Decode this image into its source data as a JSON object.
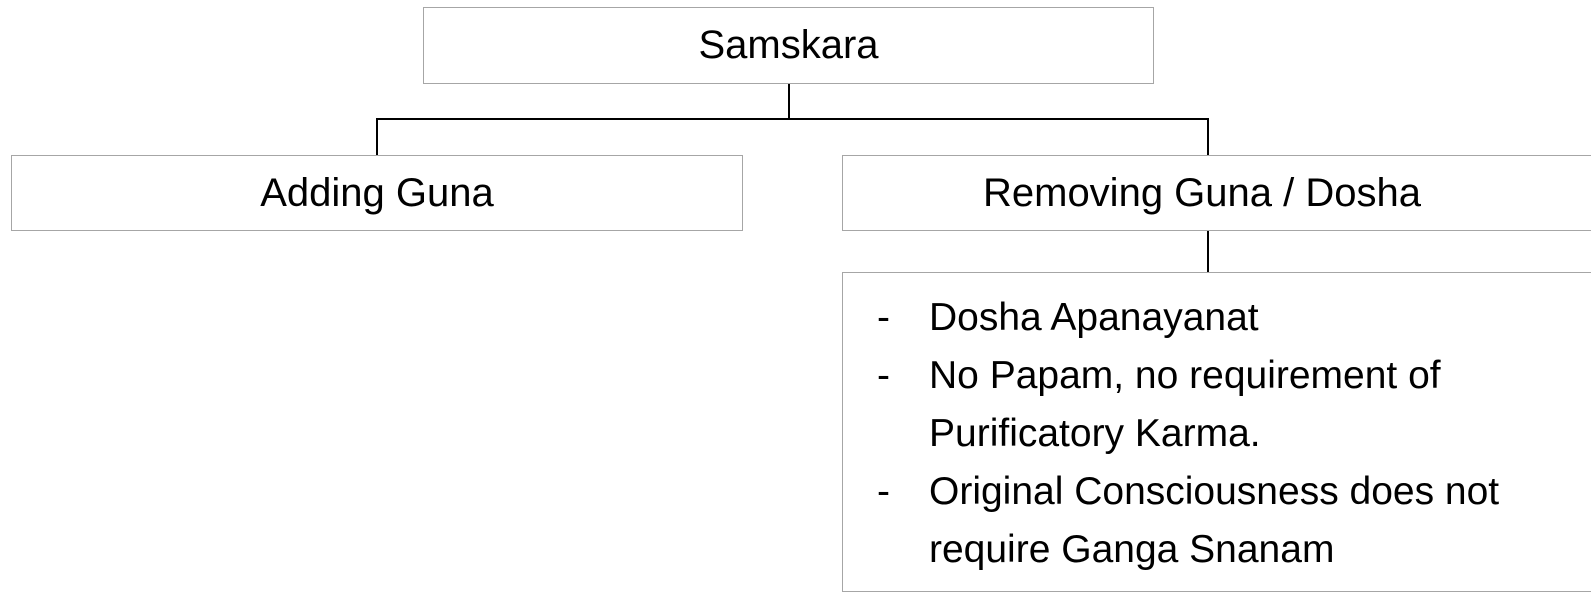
{
  "diagram": {
    "root": {
      "label": "Samskara"
    },
    "children": [
      {
        "label": "Adding Guna"
      },
      {
        "label": "Removing Guna / Dosha"
      }
    ],
    "details": {
      "bullet": "-",
      "items": [
        "Dosha Apanayanat",
        "No Papam, no requirement of Purificatory Karma.",
        "Original Consciousness does not require Ganga Snanam"
      ]
    }
  }
}
